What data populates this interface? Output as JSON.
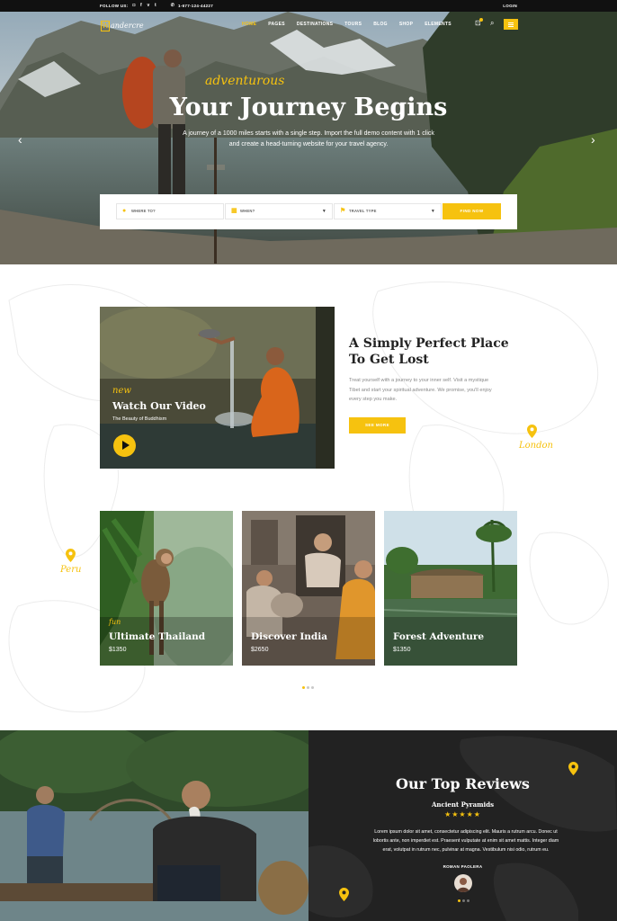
{
  "topbar": {
    "follow_label": "FOLLOW US:",
    "social": [
      "instagram-icon",
      "facebook-icon",
      "vimeo-icon",
      "tumblr-icon"
    ],
    "phone": "1-677-124-44227",
    "login": "LOGIN"
  },
  "brand": {
    "logo_mark": "W",
    "logo_text": "andercre"
  },
  "nav": {
    "items": [
      "HOME",
      "PAGES",
      "DESTINATIONS",
      "TOURS",
      "BLOG",
      "SHOP",
      "ELEMENTS"
    ],
    "active": "HOME"
  },
  "hero": {
    "script": "adventurous",
    "title": "Your Journey Begins",
    "subtitle_line1": "A journey of a 1000 miles starts with a single step. Import the full demo content with 1 click",
    "subtitle_line2": "and create a head-turning website for your travel agency."
  },
  "search": {
    "where_placeholder": "WHERE TO?",
    "when_placeholder": "WHEN?",
    "type_placeholder": "TRAVEL TYPE",
    "button": "FIND NOW"
  },
  "video": {
    "tag": "new",
    "title": "Watch Our Video",
    "subtitle": "The Beauty of Buddhism"
  },
  "intro": {
    "title_line1": "A Simply Perfect Place",
    "title_line2": "To Get Lost",
    "text": "Treat yourself with a journey to your inner self. Visit a mystique Tibet and start your spiritual adventure. We promise, you'll enjoy every step you make.",
    "button": "SEE MORE"
  },
  "map_labels": {
    "london": "London",
    "peru": "Peru"
  },
  "tours": [
    {
      "tag": "fun",
      "title": "Ultimate Thailand",
      "price": "$1350"
    },
    {
      "tag": "",
      "title": "Discover India",
      "price": "$2650"
    },
    {
      "tag": "",
      "title": "Forest Adventure",
      "price": "$1350"
    }
  ],
  "reviews": {
    "title": "Our Top Reviews",
    "subtitle": "Ancient Pyramids",
    "stars": "★★★★★",
    "text": "Lorem ipsum dolor sit amet, consectetur adipiscing elit. Mauris a rutrum arcu. Donec ut lobortis ante, non imperdiet est. Praesent vulputate at enim sit amet mattis. Integer diam erat, volutpat in rutrum nec, pulvinar at magna. Vestibulum nisi odio, rutrum eu.",
    "name": "ROMAN PAOLERA"
  },
  "colors": {
    "accent": "#f6c20f",
    "dark": "#111111",
    "reviews_bg": "#222222"
  }
}
